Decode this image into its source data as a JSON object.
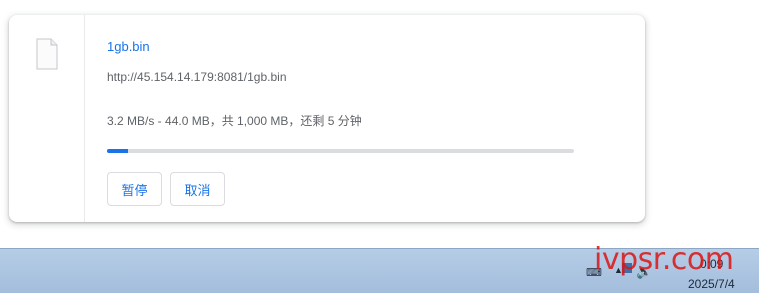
{
  "download": {
    "file_name": "1gb.bin",
    "url": "http://45.154.14.179:8081/1gb.bin",
    "status": "3.2 MB/s - 44.0 MB，共 1,000 MB，还剩 5 分钟",
    "progress_fraction": 0.044,
    "pause_label": "暂停",
    "cancel_label": "取消",
    "icon": "file-icon"
  },
  "taskbar": {
    "time": "0:09",
    "date": "2025/7/4",
    "tray_icons": [
      "keyboard-icon",
      "up-arrow-icon",
      "flag-icon",
      "speaker-icon"
    ]
  },
  "watermark": {
    "text": "ivpsr.com"
  },
  "colors": {
    "accent": "#1a73e8",
    "taskbar": "#a9c2e0",
    "watermark": "#dc1414"
  }
}
